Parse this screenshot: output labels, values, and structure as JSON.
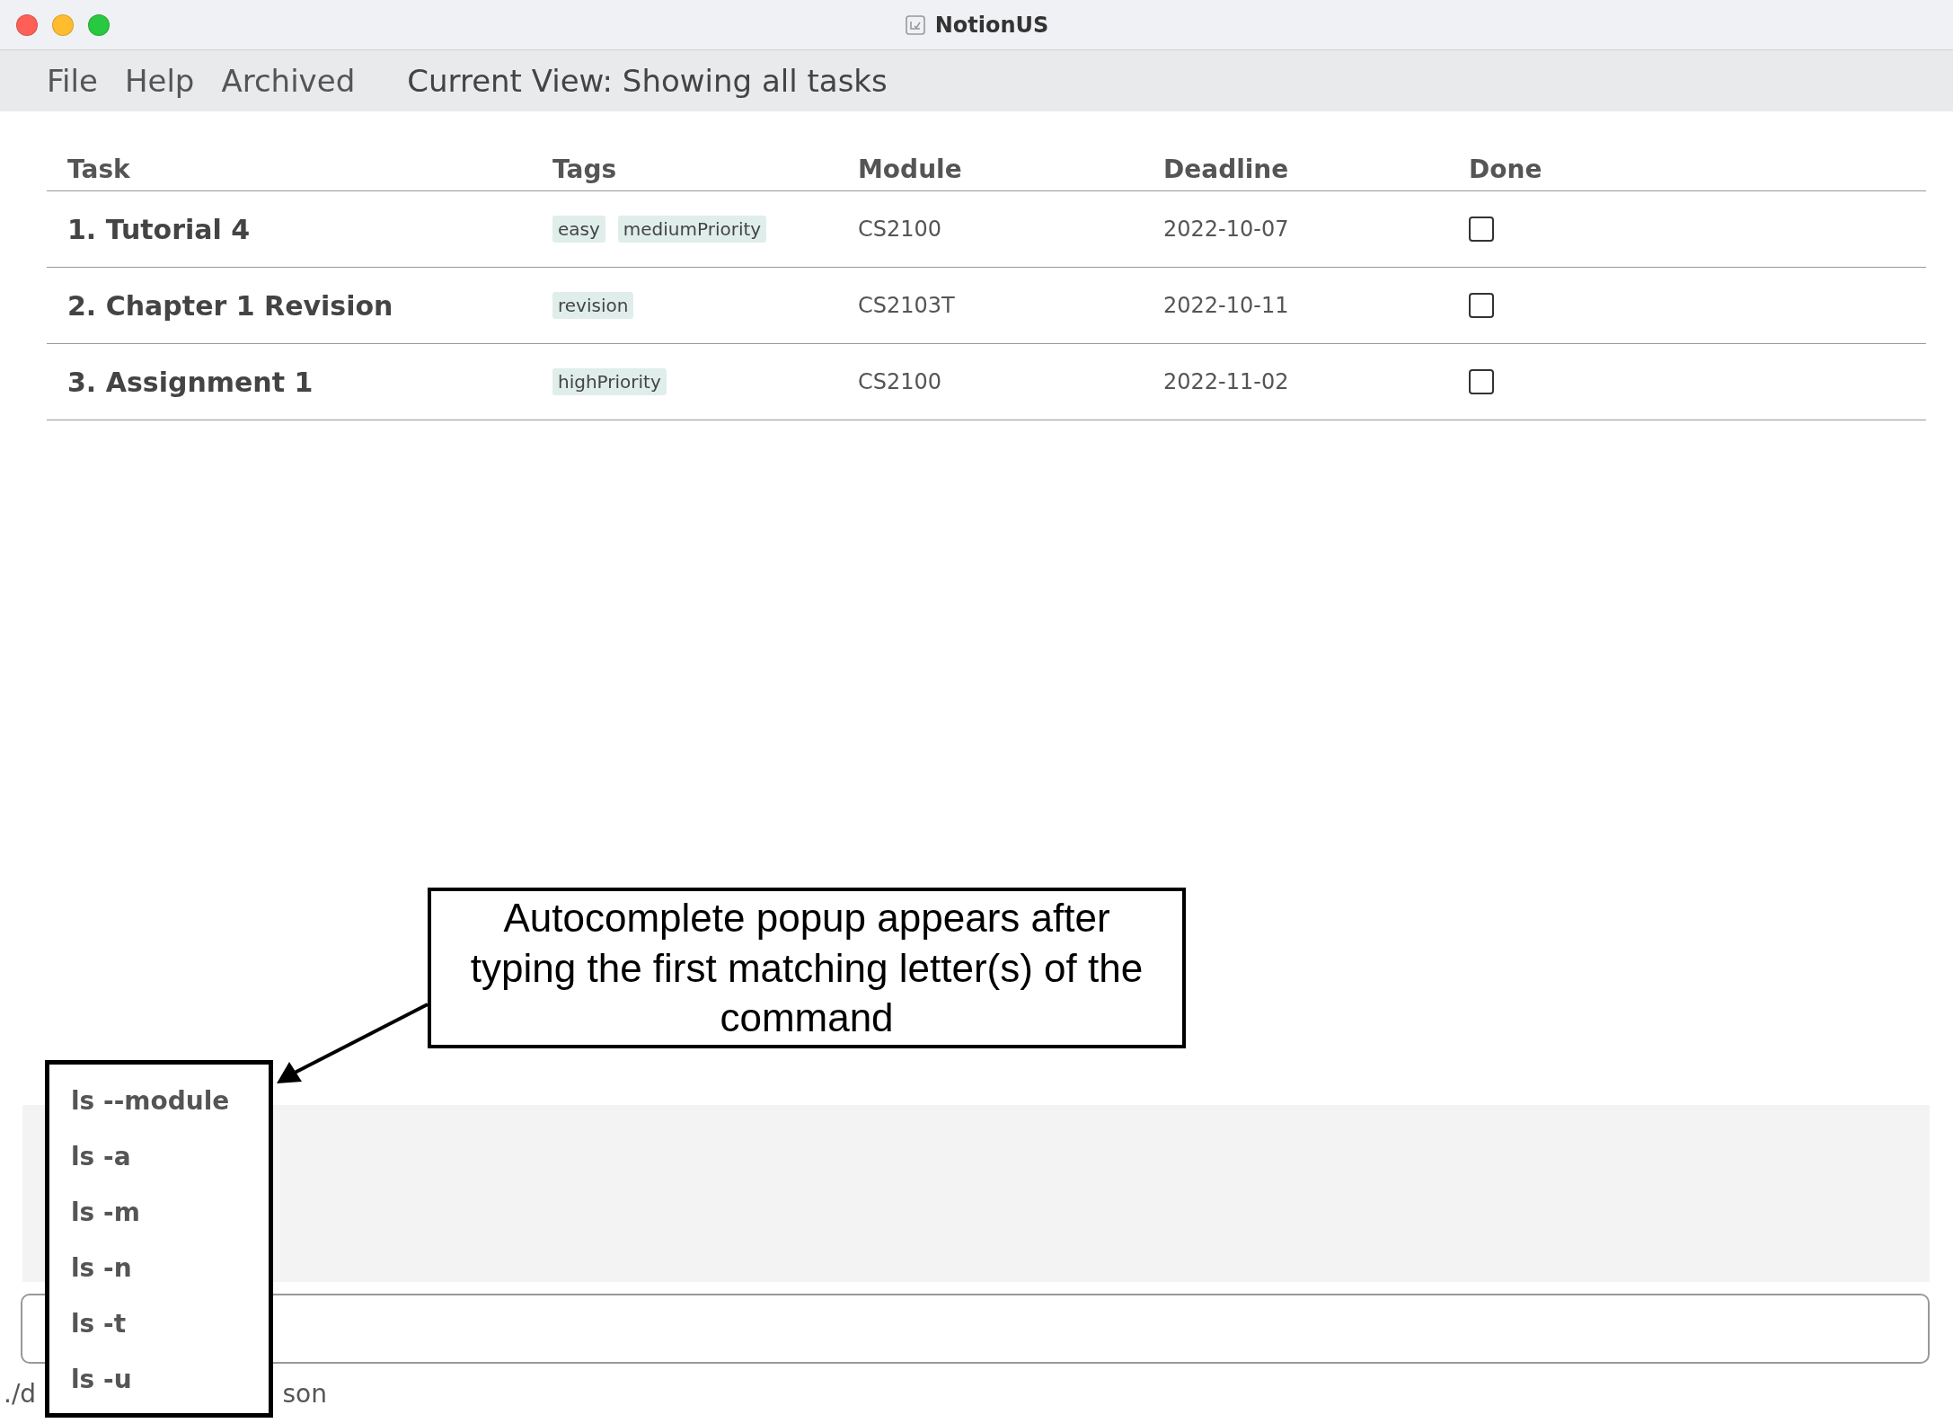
{
  "window": {
    "title": "NotionUS"
  },
  "menu": [
    "File",
    "Help",
    "Archived"
  ],
  "current_view": "Current View: Showing all tasks",
  "table": {
    "columns": [
      "Task",
      "Tags",
      "Module",
      "Deadline",
      "Done"
    ],
    "rows": [
      {
        "task": "1. Tutorial 4",
        "tags": [
          "easy",
          "mediumPriority"
        ],
        "module": "CS2100",
        "deadline": "2022-10-07",
        "done": false
      },
      {
        "task": "2. Chapter 1 Revision",
        "tags": [
          "revision"
        ],
        "module": "CS2103T",
        "deadline": "2022-10-11",
        "done": false
      },
      {
        "task": "3. Assignment 1",
        "tags": [
          "highPriority"
        ],
        "module": "CS2100",
        "deadline": "2022-11-02",
        "done": false
      }
    ]
  },
  "status_bar": [
    "./d",
    "son"
  ],
  "autocomplete": [
    "ls --module",
    "ls -a",
    "ls -m",
    "ls -n",
    "ls -t",
    "ls -u"
  ],
  "callout": "Autocomplete popup appears after typing the first matching letter(s) of the command"
}
